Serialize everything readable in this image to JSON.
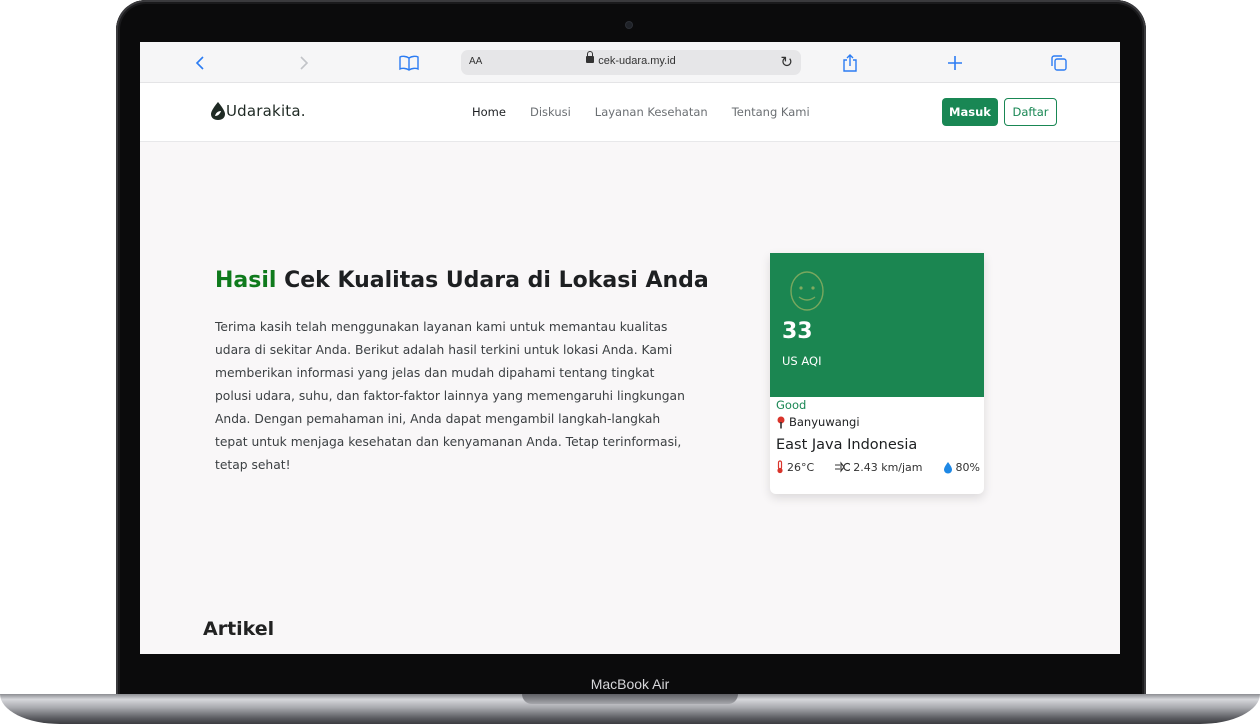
{
  "device": {
    "label": "MacBook Air"
  },
  "browser": {
    "address_prefix": "AA",
    "url": "cek-udara.my.id"
  },
  "site": {
    "brand": "Udarakita.",
    "nav": [
      {
        "label": "Home"
      },
      {
        "label": "Diskusi"
      },
      {
        "label": "Layanan Kesehatan"
      },
      {
        "label": "Tentang Kami"
      }
    ],
    "login_label": "Masuk",
    "register_label": "Daftar"
  },
  "hero": {
    "title_accent": "Hasil",
    "title_rest": " Cek Kualitas Udara di Lokasi Anda",
    "body": "Terima kasih telah menggunakan layanan kami untuk memantau kualitas udara di sekitar Anda. Berikut adalah hasil terkini untuk lokasi Anda. Kami memberikan informasi yang jelas dan mudah dipahami tentang tingkat polusi udara, suhu, dan faktor-faktor lainnya yang memengaruhi lingkungan Anda. Dengan pemahaman ini, Anda dapat mengambil langkah-langkah tepat untuk menjaga kesehatan dan kenyamanan Anda. Tetap terinformasi, tetap sehat!"
  },
  "aqi_card": {
    "value": "33",
    "unit": "US AQI",
    "status": "Good",
    "city": "Banyuwangi",
    "region": "East Java Indonesia",
    "temperature": "26°C",
    "wind": "2.43 km/jam",
    "humidity": "80%",
    "color": "#1b8651"
  },
  "sections": {
    "articles_title": "Artikel"
  }
}
